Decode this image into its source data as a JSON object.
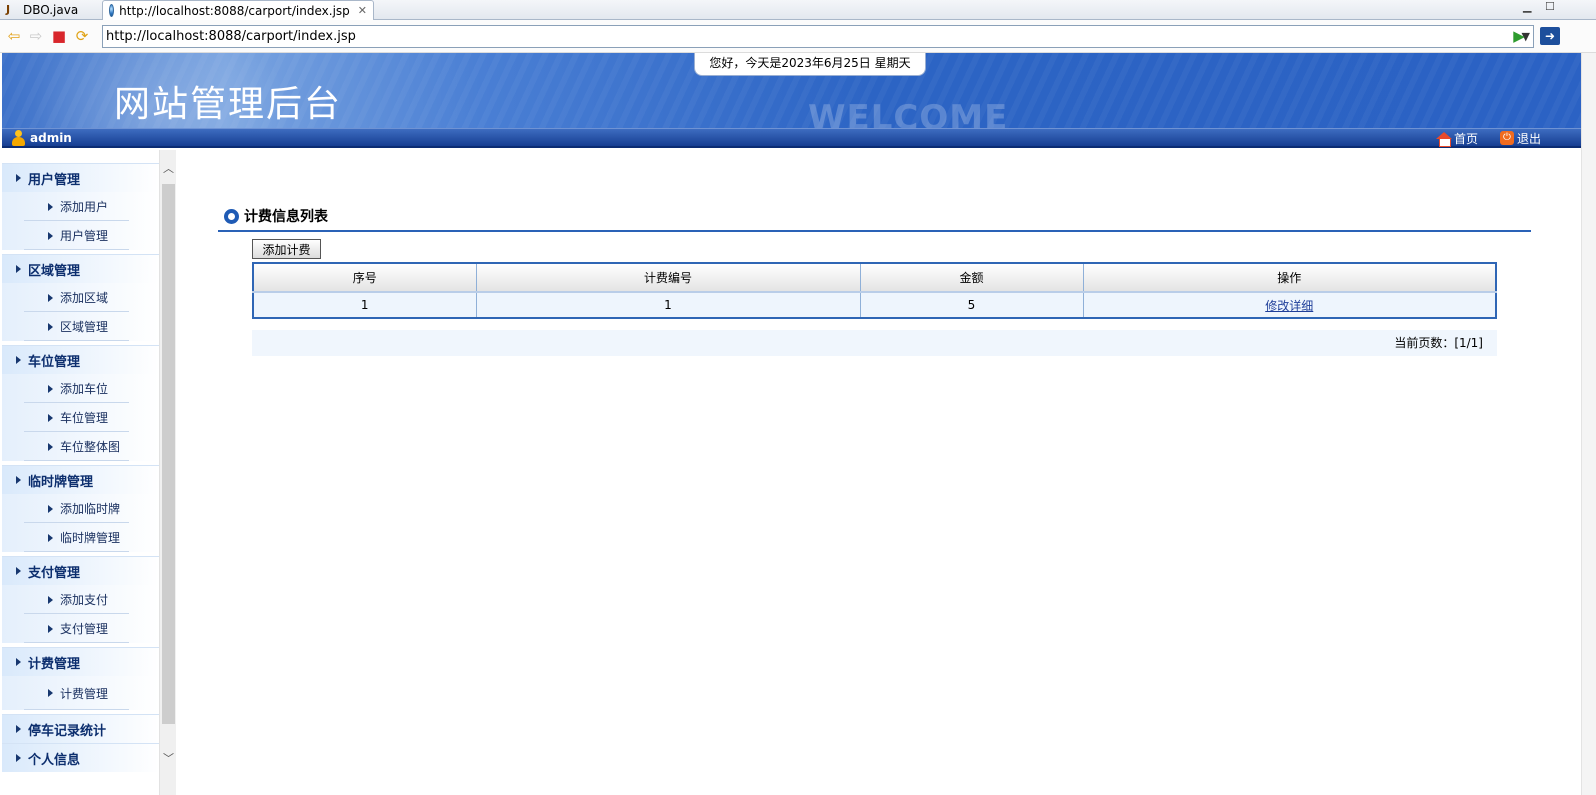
{
  "editor_tabs": [
    {
      "label": "DBO.java"
    },
    {
      "label": "http://localhost:8088/carport/index.jsp"
    }
  ],
  "browser": {
    "url": "http://localhost:8088/carport/index.jsp"
  },
  "header": {
    "site_title": "网站管理后台",
    "date_text": "您好，今天是2023年6月25日 星期天",
    "welcome_text": "WELCOME"
  },
  "navbar": {
    "user": "admin",
    "home_label": "首页",
    "logout_label": "退出"
  },
  "sidebar": {
    "groups": [
      {
        "label": "用户管理",
        "items": [
          "添加用户",
          "用户管理"
        ]
      },
      {
        "label": "区域管理",
        "items": [
          "添加区域",
          "区域管理"
        ]
      },
      {
        "label": "车位管理",
        "items": [
          "添加车位",
          "车位管理",
          "车位整体图"
        ]
      },
      {
        "label": "临时牌管理",
        "items": [
          "添加临时牌",
          "临时牌管理"
        ]
      },
      {
        "label": "支付管理",
        "items": [
          "添加支付",
          "支付管理"
        ]
      },
      {
        "label": "计费管理",
        "items": [
          "计费管理"
        ]
      },
      {
        "label": "停车记录统计",
        "items": []
      },
      {
        "label": "个人信息",
        "items": []
      }
    ]
  },
  "main": {
    "section_title": "计费信息列表",
    "add_button": "添加计费",
    "table": {
      "headers": [
        "序号",
        "计费编号",
        "金额",
        "操作"
      ],
      "rows": [
        {
          "index": "1",
          "code": "1",
          "amount": "5",
          "edit": "修改",
          "detail": "详细"
        }
      ]
    },
    "pager": "当前页数：[1/1]"
  }
}
